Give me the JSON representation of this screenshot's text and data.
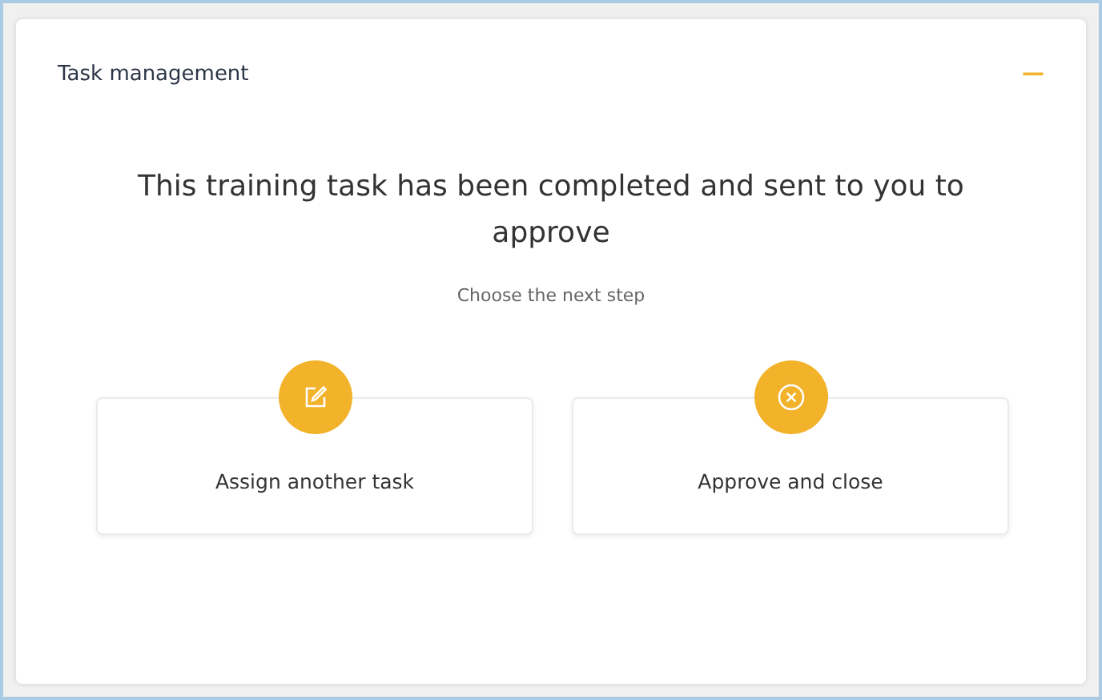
{
  "panel": {
    "title": "Task management",
    "collapse_symbol": "—"
  },
  "message": "This training task has been completed and sent to you to approve",
  "prompt": "Choose the next step",
  "options": [
    {
      "kind": "edit",
      "label": "Assign another task"
    },
    {
      "kind": "cancel",
      "label": "Approve and close"
    }
  ]
}
